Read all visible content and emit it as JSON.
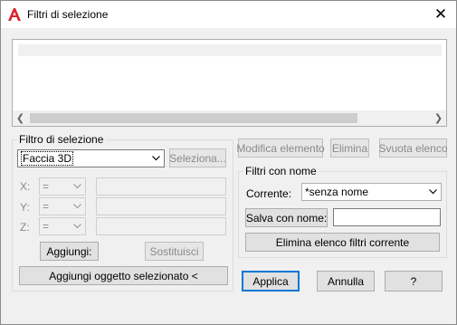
{
  "window": {
    "title": "Filtri di selezione"
  },
  "filtro": {
    "group_label": "Filtro di selezione",
    "selected_type": "Faccia 3D",
    "seleziona_label": "Seleziona...",
    "coords": [
      {
        "label": "X:",
        "operator": "="
      },
      {
        "label": "Y:",
        "operator": "="
      },
      {
        "label": "Z:",
        "operator": "="
      }
    ],
    "aggiungi_label": "Aggiungi:",
    "sostituisci_label": "Sostituisci",
    "aggiungi_oggetto_label": "Aggiungi oggetto selezionato <"
  },
  "actions": {
    "modifica_label": "Modifica elemento",
    "elimina_label": "Elimina",
    "svuota_label": "Svuota elenco"
  },
  "filtri_nome": {
    "group_label": "Filtri con nome",
    "corrente_label": "Corrente:",
    "corrente_value": "*senza nome",
    "salva_label": "Salva con nome:",
    "salva_value": "",
    "elimina_elenco_label": "Elimina elenco filtri corrente"
  },
  "footer": {
    "applica_label": "Applica",
    "annulla_label": "Annulla",
    "help_label": "?"
  },
  "colors": {
    "accent": "#0078d7",
    "app_icon": "#d9232d"
  }
}
